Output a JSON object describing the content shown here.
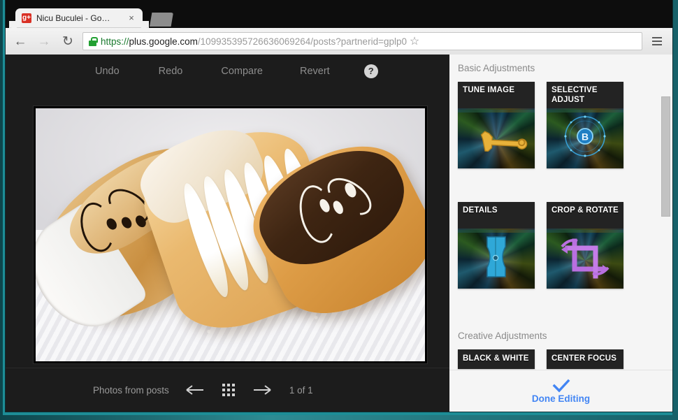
{
  "browser": {
    "tab": {
      "title": "Nicu Buculei - Google+",
      "favicon_label": "g+",
      "favicon_name": "google-plus-favicon",
      "close_label": "×"
    },
    "new_tab_name": "new-tab-button",
    "nav": {
      "back_glyph": "←",
      "forward_glyph": "→",
      "reload_glyph": "↻"
    },
    "omnibox": {
      "scheme": "https://",
      "host": "plus.google.com",
      "path": "/109935395726636069264/posts?partnerid=gplp0",
      "full_url": "https://plus.google.com/109935395726636069264/posts?partnerid=gplp0",
      "secure": true
    },
    "star_glyph": "☆",
    "menu_name": "chrome-menu-button"
  },
  "editor": {
    "toolbar": {
      "undo": "Undo",
      "redo": "Redo",
      "compare": "Compare",
      "revert": "Revert",
      "help_glyph": "?"
    },
    "filmstrip": {
      "source_label": "Photos from posts",
      "prev_glyph": "←",
      "next_glyph": "→",
      "grid_name": "grid-view-icon",
      "counter": "1 of 1"
    },
    "photo": {
      "alt": "Three éclairs on a paper doily — caramel glazed with chocolate swirls, cream filled with powdered sugar, and chocolate glazed with white icing"
    }
  },
  "panel": {
    "sections": [
      {
        "title": "Basic Adjustments",
        "tiles": [
          {
            "label": "TUNE IMAGE",
            "icon": "wrench-icon"
          },
          {
            "label": "SELECTIVE ADJUST",
            "icon": "selective-dial-icon"
          },
          {
            "label": "DETAILS",
            "icon": "sharpener-icon"
          },
          {
            "label": "CROP & ROTATE",
            "icon": "crop-rotate-icon"
          }
        ]
      },
      {
        "title": "Creative Adjustments",
        "tiles": [
          {
            "label": "BLACK & WHITE",
            "icon": "black-white-icon"
          },
          {
            "label": "CENTER FOCUS",
            "icon": "center-focus-icon"
          }
        ]
      }
    ],
    "done": {
      "label": "Done Editing",
      "check_glyph": "✓",
      "accent_color": "#4285f4"
    }
  },
  "colors": {
    "editor_background": "#1c1c1c",
    "panel_background": "#f5f5f5",
    "tile_background": "#232323",
    "accent": "#4285f4",
    "window_frame": "#1d8d96",
    "secure_lock": "#22a032"
  }
}
